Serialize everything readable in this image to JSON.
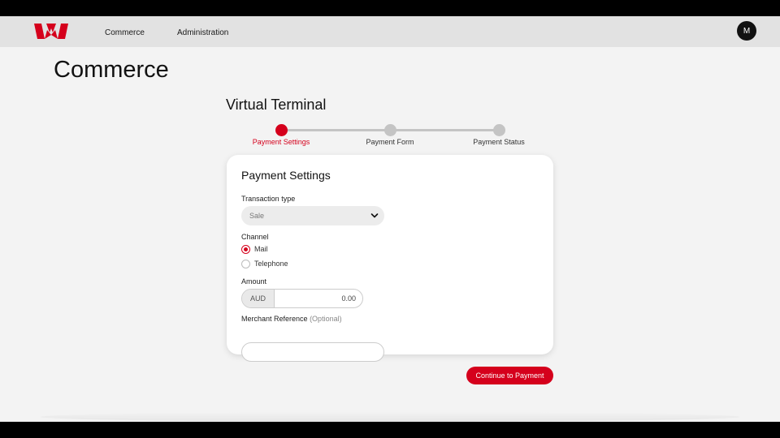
{
  "brand": {
    "accent": "#d5001c",
    "logo_icon": "westpac-w-logo"
  },
  "nav": {
    "links": [
      {
        "label": "Commerce"
      },
      {
        "label": "Administration"
      }
    ],
    "avatar_initial": "M"
  },
  "page": {
    "title": "Commerce",
    "section_title": "Virtual Terminal"
  },
  "stepper": {
    "steps": [
      {
        "label": "Payment Settings",
        "state": "active"
      },
      {
        "label": "Payment Form",
        "state": "pending"
      },
      {
        "label": "Payment Status",
        "state": "pending"
      }
    ]
  },
  "form": {
    "title": "Payment Settings",
    "transaction_type": {
      "label": "Transaction type",
      "value": "Sale",
      "icon": "chevron-down-icon"
    },
    "channel": {
      "label": "Channel",
      "options": [
        {
          "label": "Mail",
          "checked": true
        },
        {
          "label": "Telephone",
          "checked": false
        }
      ]
    },
    "amount": {
      "label": "Amount",
      "currency": "AUD",
      "value": "0.00"
    },
    "merchant_reference": {
      "label": "Merchant Reference",
      "optional": "(Optional)",
      "value": ""
    }
  },
  "actions": {
    "continue_label": "Continue to Payment"
  }
}
